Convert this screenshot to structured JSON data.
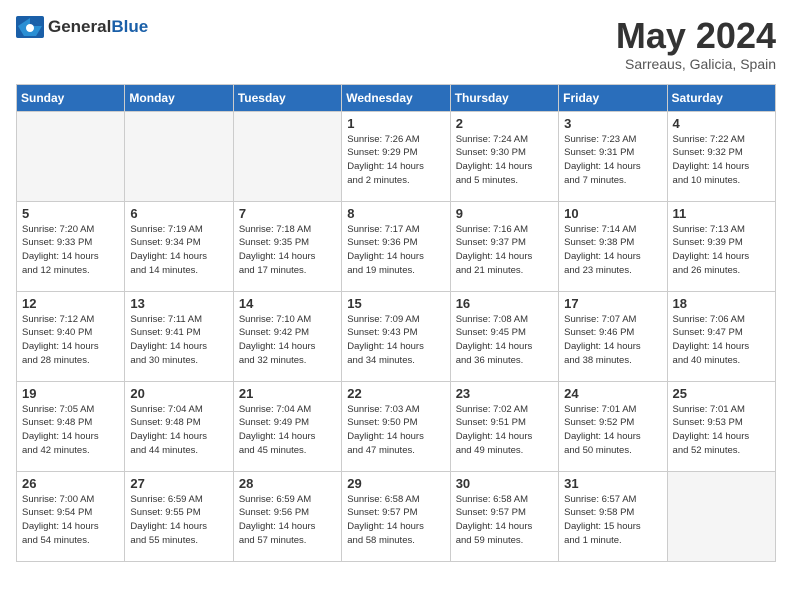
{
  "header": {
    "logo_general": "General",
    "logo_blue": "Blue",
    "month_title": "May 2024",
    "subtitle": "Sarreaus, Galicia, Spain"
  },
  "weekdays": [
    "Sunday",
    "Monday",
    "Tuesday",
    "Wednesday",
    "Thursday",
    "Friday",
    "Saturday"
  ],
  "weeks": [
    [
      {
        "day": "",
        "info": ""
      },
      {
        "day": "",
        "info": ""
      },
      {
        "day": "",
        "info": ""
      },
      {
        "day": "1",
        "info": "Sunrise: 7:26 AM\nSunset: 9:29 PM\nDaylight: 14 hours\nand 2 minutes."
      },
      {
        "day": "2",
        "info": "Sunrise: 7:24 AM\nSunset: 9:30 PM\nDaylight: 14 hours\nand 5 minutes."
      },
      {
        "day": "3",
        "info": "Sunrise: 7:23 AM\nSunset: 9:31 PM\nDaylight: 14 hours\nand 7 minutes."
      },
      {
        "day": "4",
        "info": "Sunrise: 7:22 AM\nSunset: 9:32 PM\nDaylight: 14 hours\nand 10 minutes."
      }
    ],
    [
      {
        "day": "5",
        "info": "Sunrise: 7:20 AM\nSunset: 9:33 PM\nDaylight: 14 hours\nand 12 minutes."
      },
      {
        "day": "6",
        "info": "Sunrise: 7:19 AM\nSunset: 9:34 PM\nDaylight: 14 hours\nand 14 minutes."
      },
      {
        "day": "7",
        "info": "Sunrise: 7:18 AM\nSunset: 9:35 PM\nDaylight: 14 hours\nand 17 minutes."
      },
      {
        "day": "8",
        "info": "Sunrise: 7:17 AM\nSunset: 9:36 PM\nDaylight: 14 hours\nand 19 minutes."
      },
      {
        "day": "9",
        "info": "Sunrise: 7:16 AM\nSunset: 9:37 PM\nDaylight: 14 hours\nand 21 minutes."
      },
      {
        "day": "10",
        "info": "Sunrise: 7:14 AM\nSunset: 9:38 PM\nDaylight: 14 hours\nand 23 minutes."
      },
      {
        "day": "11",
        "info": "Sunrise: 7:13 AM\nSunset: 9:39 PM\nDaylight: 14 hours\nand 26 minutes."
      }
    ],
    [
      {
        "day": "12",
        "info": "Sunrise: 7:12 AM\nSunset: 9:40 PM\nDaylight: 14 hours\nand 28 minutes."
      },
      {
        "day": "13",
        "info": "Sunrise: 7:11 AM\nSunset: 9:41 PM\nDaylight: 14 hours\nand 30 minutes."
      },
      {
        "day": "14",
        "info": "Sunrise: 7:10 AM\nSunset: 9:42 PM\nDaylight: 14 hours\nand 32 minutes."
      },
      {
        "day": "15",
        "info": "Sunrise: 7:09 AM\nSunset: 9:43 PM\nDaylight: 14 hours\nand 34 minutes."
      },
      {
        "day": "16",
        "info": "Sunrise: 7:08 AM\nSunset: 9:45 PM\nDaylight: 14 hours\nand 36 minutes."
      },
      {
        "day": "17",
        "info": "Sunrise: 7:07 AM\nSunset: 9:46 PM\nDaylight: 14 hours\nand 38 minutes."
      },
      {
        "day": "18",
        "info": "Sunrise: 7:06 AM\nSunset: 9:47 PM\nDaylight: 14 hours\nand 40 minutes."
      }
    ],
    [
      {
        "day": "19",
        "info": "Sunrise: 7:05 AM\nSunset: 9:48 PM\nDaylight: 14 hours\nand 42 minutes."
      },
      {
        "day": "20",
        "info": "Sunrise: 7:04 AM\nSunset: 9:48 PM\nDaylight: 14 hours\nand 44 minutes."
      },
      {
        "day": "21",
        "info": "Sunrise: 7:04 AM\nSunset: 9:49 PM\nDaylight: 14 hours\nand 45 minutes."
      },
      {
        "day": "22",
        "info": "Sunrise: 7:03 AM\nSunset: 9:50 PM\nDaylight: 14 hours\nand 47 minutes."
      },
      {
        "day": "23",
        "info": "Sunrise: 7:02 AM\nSunset: 9:51 PM\nDaylight: 14 hours\nand 49 minutes."
      },
      {
        "day": "24",
        "info": "Sunrise: 7:01 AM\nSunset: 9:52 PM\nDaylight: 14 hours\nand 50 minutes."
      },
      {
        "day": "25",
        "info": "Sunrise: 7:01 AM\nSunset: 9:53 PM\nDaylight: 14 hours\nand 52 minutes."
      }
    ],
    [
      {
        "day": "26",
        "info": "Sunrise: 7:00 AM\nSunset: 9:54 PM\nDaylight: 14 hours\nand 54 minutes."
      },
      {
        "day": "27",
        "info": "Sunrise: 6:59 AM\nSunset: 9:55 PM\nDaylight: 14 hours\nand 55 minutes."
      },
      {
        "day": "28",
        "info": "Sunrise: 6:59 AM\nSunset: 9:56 PM\nDaylight: 14 hours\nand 57 minutes."
      },
      {
        "day": "29",
        "info": "Sunrise: 6:58 AM\nSunset: 9:57 PM\nDaylight: 14 hours\nand 58 minutes."
      },
      {
        "day": "30",
        "info": "Sunrise: 6:58 AM\nSunset: 9:57 PM\nDaylight: 14 hours\nand 59 minutes."
      },
      {
        "day": "31",
        "info": "Sunrise: 6:57 AM\nSunset: 9:58 PM\nDaylight: 15 hours\nand 1 minute."
      },
      {
        "day": "",
        "info": ""
      }
    ]
  ]
}
